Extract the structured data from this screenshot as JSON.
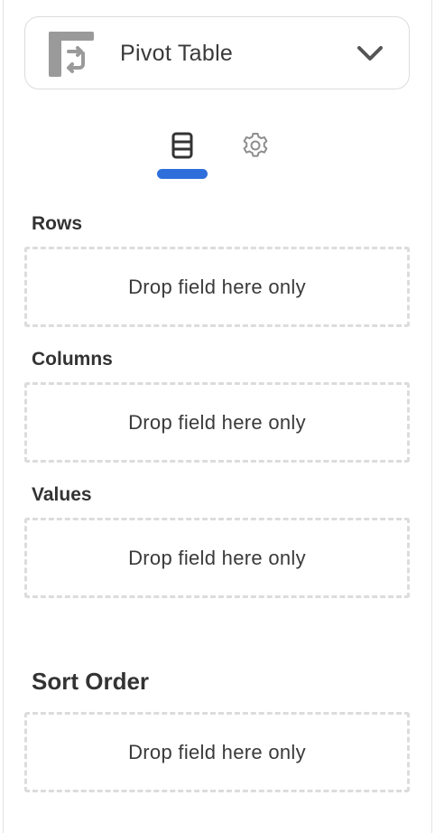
{
  "visualization": {
    "label": "Pivot Table",
    "icon": "pivot-table-icon",
    "chevron_icon": "chevron-down-icon"
  },
  "tabs": [
    {
      "name": "fields",
      "icon": "fields-icon",
      "active": true
    },
    {
      "name": "settings",
      "icon": "gear-icon",
      "active": false
    }
  ],
  "sections": {
    "rows": {
      "label": "Rows",
      "placeholder": "Drop field here only"
    },
    "columns": {
      "label": "Columns",
      "placeholder": "Drop field here only"
    },
    "values": {
      "label": "Values",
      "placeholder": "Drop field here only"
    },
    "sort_order": {
      "label": "Sort Order",
      "placeholder": "Drop field here only"
    }
  },
  "colors": {
    "accent": "#2f6fdb",
    "icon_gray": "#9a9a9a",
    "border": "#dcdcdc"
  }
}
